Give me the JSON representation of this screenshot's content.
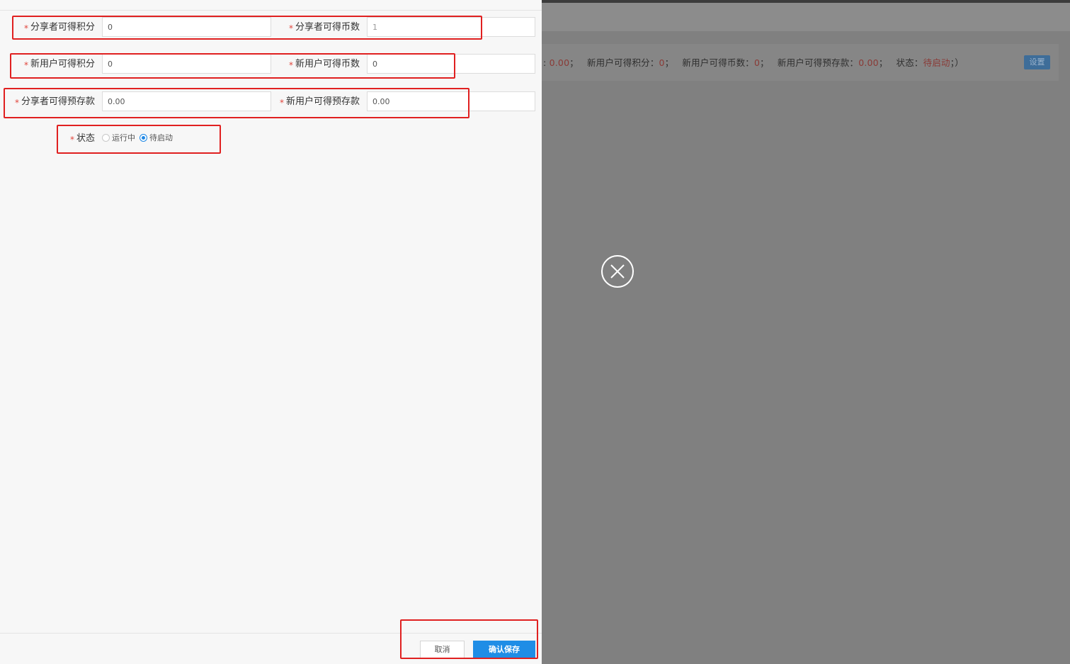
{
  "background": {
    "info_segments": [
      {
        "label": ": ",
        "value": "0.00",
        "suffix": "；"
      },
      {
        "label": "新用户可得积分：",
        "value": "0",
        "suffix": "；"
      },
      {
        "label": "新用户可得币数：",
        "value": "0",
        "suffix": "；"
      },
      {
        "label": "新用户可得预存款：",
        "value": "0.00",
        "suffix": "；"
      },
      {
        "label": "状态：",
        "value": "待启动",
        "suffix": "；）"
      }
    ],
    "set_button_label": "设置",
    "value_color": "#8a3a36"
  },
  "form": {
    "required_mark": "*",
    "sharer_points": {
      "label": "分享者可得积分",
      "value": "0"
    },
    "sharer_coins": {
      "label": "分享者可得币数",
      "value": "1"
    },
    "new_user_points": {
      "label": "新用户可得积分",
      "value": "0"
    },
    "new_user_coins": {
      "label": "新用户可得币数",
      "value": "0"
    },
    "sharer_deposit": {
      "label": "分享者可得预存款",
      "value": "0.00"
    },
    "new_user_deposit": {
      "label": "新用户可得预存款",
      "value": "0.00"
    },
    "status": {
      "label": "状态",
      "options": [
        "运行中",
        "待启动"
      ],
      "selected": "待启动"
    }
  },
  "footer": {
    "cancel_label": "取消",
    "save_label": "确认保存"
  },
  "colors": {
    "accent": "#1f8de6",
    "required": "#e0453c",
    "annotation": "#e02020",
    "overlay": "#808080"
  },
  "icons": {
    "close": "close-circle-icon"
  }
}
